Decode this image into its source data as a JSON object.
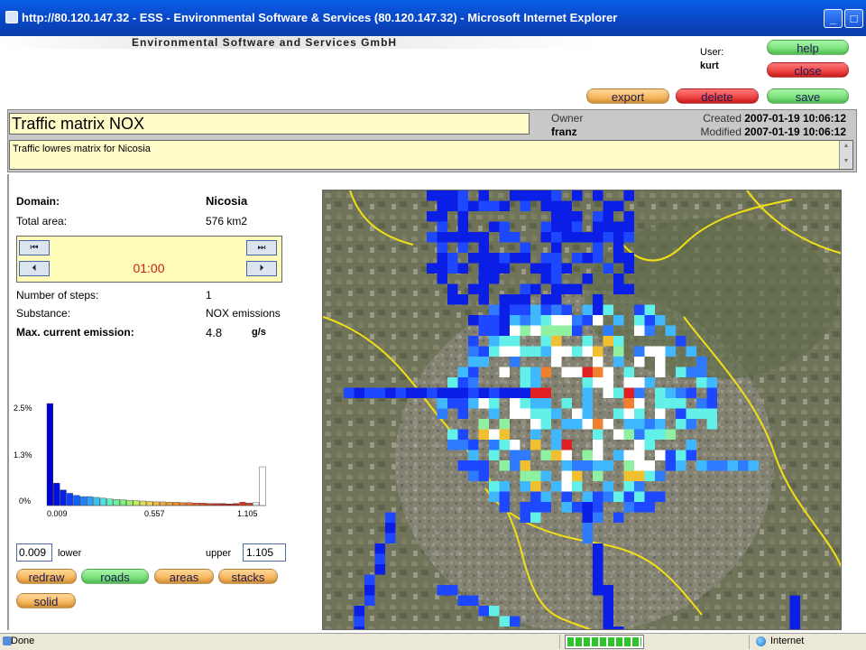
{
  "window": {
    "title": "http://80.120.147.32 - ESS - Environmental Software & Services (80.120.147.32) - Microsoft Internet Explorer",
    "min_glyph": "_",
    "max_glyph": "□"
  },
  "header": {
    "company": "Environmental Software and Services GmbH",
    "user_label": "User:",
    "user_name": "kurt",
    "help": "help",
    "close": "close",
    "export": "export",
    "delete": "delete",
    "save": "save"
  },
  "matrix": {
    "title": "Traffic matrix NOX",
    "owner_label": "Owner",
    "owner": "franz",
    "created_label": "Created",
    "created": "2007-01-19 10:06:12",
    "modified_label": "Modified",
    "modified": "2007-01-19 10:06:12",
    "description": "Traffic lowres matrix for Nicosia"
  },
  "details": {
    "domain_label": "Domain:",
    "domain": "Nicosia",
    "area_label": "Total area:",
    "area": "576 km2",
    "time": "01:00",
    "steps_label": "Number of steps:",
    "steps": "1",
    "substance_label": "Substance:",
    "substance": "NOX emissions",
    "max_label": "Max. current emission:",
    "max_value": "4.8",
    "max_unit": "g/s"
  },
  "player": {
    "first_glyph": "⏮",
    "prev_glyph": "⏴",
    "last_glyph": "⏭",
    "next_glyph": "⏵"
  },
  "range": {
    "lower": "0.009",
    "lower_label": "lower",
    "upper_label": "upper",
    "upper": "1.105"
  },
  "buttons": {
    "redraw": "redraw",
    "roads": "roads",
    "areas": "areas",
    "stacks": "stacks",
    "solid": "solid"
  },
  "chart_data": {
    "type": "bar",
    "y_ticks": [
      "2.5%",
      "1.3%",
      "0%"
    ],
    "x_ticks": [
      "0.009",
      "0.557",
      "1.105"
    ],
    "ylim": [
      0,
      2.5
    ],
    "values": [
      2.5,
      0.55,
      0.38,
      0.3,
      0.25,
      0.22,
      0.22,
      0.2,
      0.18,
      0.16,
      0.15,
      0.14,
      0.13,
      0.12,
      0.11,
      0.1,
      0.09,
      0.09,
      0.08,
      0.08,
      0.07,
      0.07,
      0.06,
      0.06,
      0.05,
      0.05,
      0.05,
      0.04,
      0.05,
      0.08,
      0.06,
      0.07,
      0.95
    ],
    "colors": [
      "#0000d0",
      "#0010e0",
      "#0020f0",
      "#1040ff",
      "#1060ff",
      "#2080ff",
      "#30a0ff",
      "#40c0f0",
      "#50e0e0",
      "#60f0c0",
      "#70f0a0",
      "#80f080",
      "#a0f070",
      "#c0f060",
      "#e0e060",
      "#f0d050",
      "#f0c040",
      "#f0b040",
      "#f0a030",
      "#f09030",
      "#f08030",
      "#f07030",
      "#e86028",
      "#e05020",
      "#d84020",
      "#d03020",
      "#c82020",
      "#c01818",
      "#d02020",
      "#e03020",
      "#e04020",
      "#f0f0f0",
      "#ffffff"
    ]
  },
  "status": {
    "text": "Done",
    "zone": "Internet",
    "progress_fraction": 1.0
  }
}
